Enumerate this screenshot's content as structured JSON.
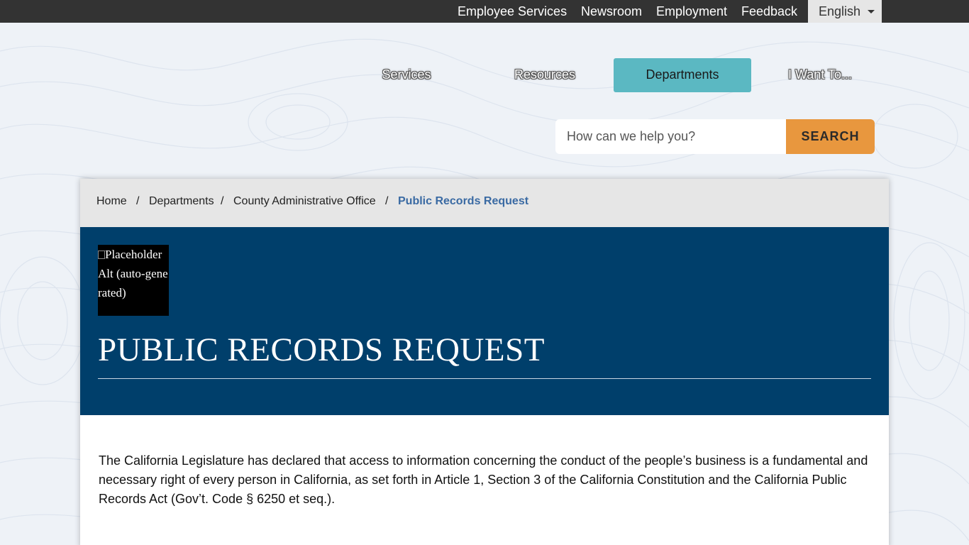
{
  "topbar": {
    "links": [
      "Employee Services",
      "Newsroom",
      "Employment",
      "Feedback"
    ],
    "language": "English"
  },
  "nav": {
    "items": [
      "Services",
      "Resources",
      "Departments",
      "I Want To..."
    ],
    "active": "Departments"
  },
  "search": {
    "placeholder": "How can we help you?",
    "button_label": "SEARCH"
  },
  "breadcrumb": {
    "items": [
      "Home",
      "Departments",
      "County Administrative Office"
    ],
    "separator": "/",
    "current": "Public Records Request"
  },
  "hero": {
    "image_alt": "Placeholder Alt (auto-generated)",
    "title": "PUBLIC RECORDS REQUEST"
  },
  "content": {
    "paragraph": "The California Legislature has declared that access to information concerning the conduct of the people’s business is a fundamental and necessary right of every person in California, as set forth in Article 1, Section 3 of the California Constitution and the California Public Records Act (Gov’t. Code § 6250 et seq.)."
  },
  "colors": {
    "topbar": "#333333",
    "nav_active": "#5bb8c2",
    "search_button": "#e8973e",
    "hero_background": "#003f6b",
    "breadcrumb_current": "#3a6aa3"
  }
}
